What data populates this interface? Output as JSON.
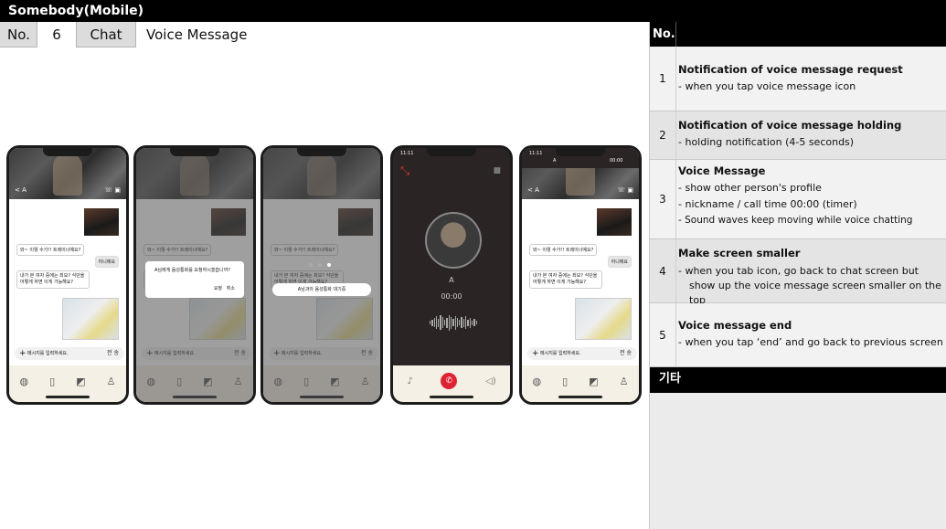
{
  "header": {
    "app_title": "Somebody(Mobile)"
  },
  "meta_row": {
    "no_label": "No.",
    "no_value": "6",
    "category": "Chat",
    "screen_title": "Voice Message"
  },
  "panel": {
    "no_label": "No.",
    "items": [
      {
        "num": "1",
        "title": "Notification of voice message request",
        "lines": [
          "- when you tap voice message icon"
        ]
      },
      {
        "num": "2",
        "title": "Notification of voice message holding",
        "lines": [
          "- holding notification (4-5 seconds)"
        ]
      },
      {
        "num": "3",
        "title": "Voice Message",
        "lines": [
          "-  show other person's profile",
          "- nickname / call time 00:00 (timer)",
          "-   Sound waves keep moving while voice chatting"
        ]
      },
      {
        "num": "4",
        "title": "Make screen smaller",
        "lines": [
          "- when you tab icon, go back to chat screen but show up the voice message screen smaller on the top"
        ]
      },
      {
        "num": "5",
        "title": "Voice message end",
        "lines": [
          "- when you tap ‘end’ and go back to previous screen"
        ]
      }
    ],
    "etc_label": "기타"
  },
  "phone": {
    "back": "< A",
    "msg1": "와~ 이렇 수가!! 트레이너예요?",
    "msg2": "아니에요",
    "msg3": "내가 본 여자 중에는 최모? 식단을 어떻게 하면 이게 가능해요?",
    "input_placeholder": "메시지를 입력하세요.",
    "send": "전 송",
    "dialog_text": "A님에게 음성통화를 요청하시겠습니까?",
    "dialog_ok": "요청",
    "dialog_cancel": "취소",
    "hold_text": "A님과의 음성통화 대기중",
    "status_time": "11:11",
    "call_name": "A",
    "call_time": "00:00",
    "mini_name": "A",
    "mini_time": "00:00"
  }
}
